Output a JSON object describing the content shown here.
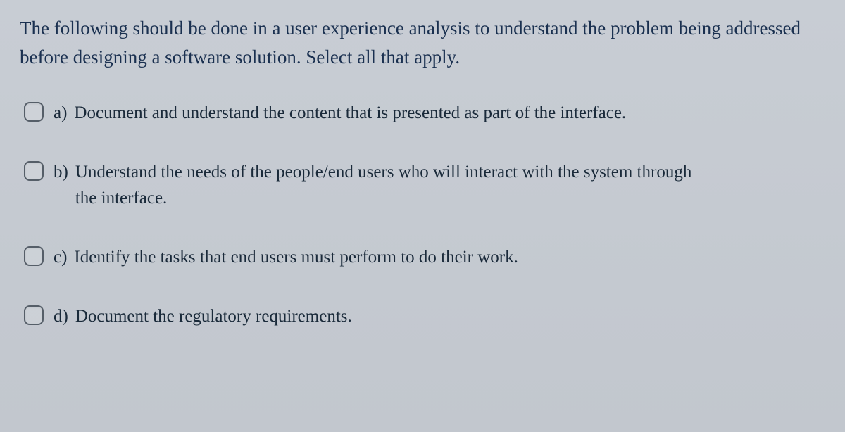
{
  "question": {
    "prompt": "The following should be done in a user experience analysis to understand the problem being addressed before designing a software solution. Select all that apply.",
    "options": [
      {
        "letter": "a)",
        "text": "Document and understand the content that is presented as part of the interface.",
        "checked": false
      },
      {
        "letter": "b)",
        "text": "Understand the needs of the people/end users who will interact with the system through the interface.",
        "checked": false
      },
      {
        "letter": "c)",
        "text": "Identify the tasks that end users must perform to do their work.",
        "checked": false
      },
      {
        "letter": "d)",
        "text": "Document the regulatory requirements.",
        "checked": false
      }
    ]
  }
}
